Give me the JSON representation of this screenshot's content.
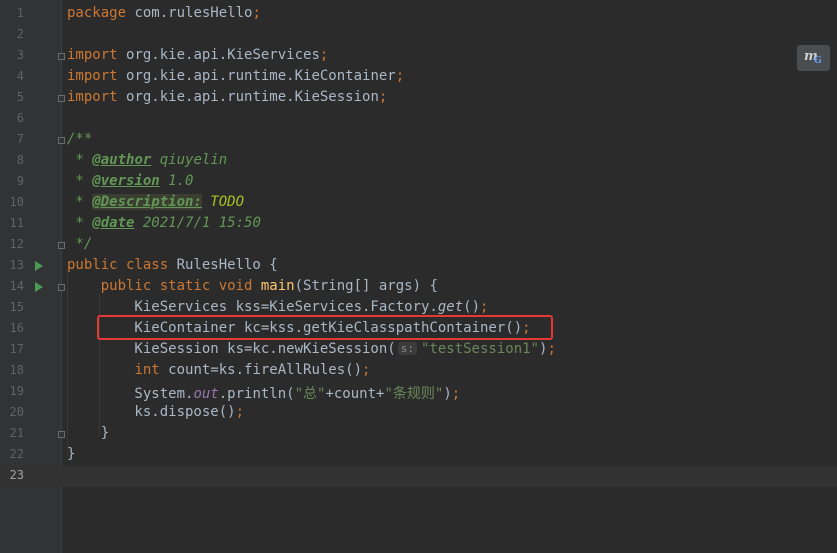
{
  "editor": {
    "language": "java",
    "current_line": "23",
    "plugin_badge": {
      "icon": "mybatis-plugin-icon",
      "letter": "m",
      "sub": "G"
    },
    "highlight_color": "#e53935",
    "lines": [
      {
        "n": "1",
        "tokens": [
          [
            "kw",
            "package "
          ],
          [
            "pl",
            "com.rulesHello"
          ],
          [
            "kw",
            ";"
          ]
        ]
      },
      {
        "n": "2",
        "tokens": []
      },
      {
        "n": "3",
        "tokens": [
          [
            "kw",
            "import "
          ],
          [
            "pl",
            "org.kie.api.KieServices"
          ],
          [
            "kw",
            ";"
          ]
        ]
      },
      {
        "n": "4",
        "tokens": [
          [
            "kw",
            "import "
          ],
          [
            "pl",
            "org.kie.api.runtime.KieContainer"
          ],
          [
            "kw",
            ";"
          ]
        ]
      },
      {
        "n": "5",
        "tokens": [
          [
            "kw",
            "import "
          ],
          [
            "pl",
            "org.kie.api.runtime.KieSession"
          ],
          [
            "kw",
            ";"
          ]
        ]
      },
      {
        "n": "6",
        "tokens": []
      },
      {
        "n": "7",
        "tokens": [
          [
            "doc",
            "/**"
          ]
        ]
      },
      {
        "n": "8",
        "tokens": [
          [
            "doc",
            " * "
          ],
          [
            "tag",
            "@author"
          ],
          [
            "doc",
            " qiuyelin"
          ]
        ]
      },
      {
        "n": "9",
        "tokens": [
          [
            "doc",
            " * "
          ],
          [
            "tag",
            "@version"
          ],
          [
            "doc",
            " 1.0"
          ]
        ]
      },
      {
        "n": "10",
        "tokens": [
          [
            "doc",
            " * "
          ],
          [
            "tagbg",
            "@Description:"
          ],
          [
            "todo",
            " TODO"
          ]
        ]
      },
      {
        "n": "11",
        "tokens": [
          [
            "doc",
            " * "
          ],
          [
            "tag",
            "@date"
          ],
          [
            "doc",
            " 2021/7/1 15:50"
          ]
        ]
      },
      {
        "n": "12",
        "tokens": [
          [
            "doc",
            " */"
          ]
        ]
      },
      {
        "n": "13",
        "tokens": [
          [
            "kw",
            "public class "
          ],
          [
            "pl",
            "RulesHello {"
          ]
        ]
      },
      {
        "n": "14",
        "tokens": [
          [
            "pl",
            "    "
          ],
          [
            "kw",
            "public static void "
          ],
          [
            "fn",
            "main"
          ],
          [
            "pl",
            "(String[] args) {"
          ]
        ]
      },
      {
        "n": "15",
        "tokens": [
          [
            "pl",
            "        KieServices kss=KieServices.Factory."
          ],
          [
            "it",
            "get"
          ],
          [
            "pl",
            "()"
          ],
          [
            "kw",
            ";"
          ]
        ]
      },
      {
        "n": "16",
        "tokens": [
          [
            "pl",
            "        KieContainer kc=kss.getKieClasspathContainer()"
          ],
          [
            "kw",
            ";"
          ]
        ]
      },
      {
        "n": "17",
        "tokens": [
          [
            "pl",
            "        KieSession ks=kc.newKieSession("
          ],
          [
            "hint",
            "s:"
          ],
          [
            "str",
            "\"testSession1\""
          ],
          [
            "pl",
            ")"
          ],
          [
            "kw",
            ";"
          ]
        ]
      },
      {
        "n": "18",
        "tokens": [
          [
            "pl",
            "        "
          ],
          [
            "kw",
            "int "
          ],
          [
            "pl",
            "count=ks.fireAllRules()"
          ],
          [
            "kw",
            ";"
          ]
        ]
      },
      {
        "n": "19",
        "tokens": [
          [
            "pl",
            "        System."
          ],
          [
            "field",
            "out"
          ],
          [
            "pl",
            ".println("
          ],
          [
            "str",
            "\"总\""
          ],
          [
            "pl",
            "+count+"
          ],
          [
            "str",
            "\"条规则\""
          ],
          [
            "pl",
            ")"
          ],
          [
            "kw",
            ";"
          ]
        ]
      },
      {
        "n": "20",
        "tokens": [
          [
            "pl",
            "        ks.dispose()"
          ],
          [
            "kw",
            ";"
          ]
        ]
      },
      {
        "n": "21",
        "tokens": [
          [
            "pl",
            "    }"
          ]
        ]
      },
      {
        "n": "22",
        "tokens": [
          [
            "pl",
            "}"
          ]
        ]
      },
      {
        "n": "23",
        "tokens": []
      }
    ],
    "run_markers": [
      "13",
      "14"
    ],
    "fold_markers": [
      "3",
      "5",
      "7",
      "12",
      "14",
      "21"
    ]
  }
}
